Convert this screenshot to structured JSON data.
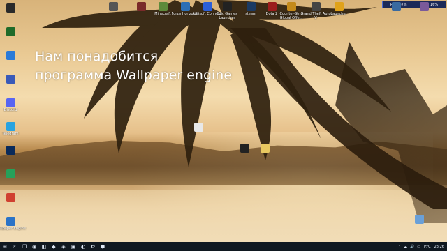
{
  "overlay": {
    "line1": "Нам понадобится",
    "line2": "программа Wallpaper engine"
  },
  "sysmon": {
    "ram": "RAM 37%",
    "cpu": "CPU 16%"
  },
  "top_icons": [
    {
      "label": "",
      "icon": "app-icon",
      "color": "#555"
    },
    {
      "label": "",
      "icon": "app-icon",
      "color": "#7a2a2a"
    },
    {
      "label": "Minecraft",
      "icon": "minecraft-icon",
      "color": "#5d8a3a"
    },
    {
      "label": "Forza Horizon 4",
      "icon": "forza-icon",
      "color": "#2d6fb5"
    },
    {
      "label": "Ubisoft Connect",
      "icon": "ubisoft-icon",
      "color": "#2b5fd9"
    },
    {
      "label": "Epic Games Launcher",
      "icon": "epic-icon",
      "color": "#222"
    },
    {
      "label": "steam",
      "icon": "steam-icon",
      "color": "#1b3a63"
    },
    {
      "label": "Dota 2",
      "icon": "dota-icon",
      "color": "#9b1c1c"
    },
    {
      "label": "Counter-Str... Global Offe...",
      "icon": "csgo-icon",
      "color": "#c48a1a"
    },
    {
      "label": "Grand Theft Auto V",
      "icon": "gta-icon",
      "color": "#444"
    },
    {
      "label": "Launcher",
      "icon": "launcher-icon",
      "color": "#e0a21a"
    },
    {
      "label": "",
      "icon": "app-icon",
      "color": "#3a6aa0"
    },
    {
      "label": "",
      "icon": "app-icon",
      "color": "#7a5a9a"
    }
  ],
  "left_icons": [
    {
      "label": "",
      "icon": "app-icon",
      "color": "#2a2a2a"
    },
    {
      "label": "",
      "icon": "app-icon",
      "color": "#1f6b2a"
    },
    {
      "label": "",
      "icon": "app-icon",
      "color": "#2a7ad8"
    },
    {
      "label": "",
      "icon": "app-icon",
      "color": "#3a5ab8"
    },
    {
      "label": "Discord",
      "icon": "discord-icon",
      "color": "#5865f2"
    },
    {
      "label": "Telegram",
      "icon": "telegram-icon",
      "color": "#2aa3e0"
    },
    {
      "label": "",
      "icon": "app-icon",
      "color": "#0a2a5a"
    },
    {
      "label": "",
      "icon": "app-icon",
      "color": "#26a05a"
    },
    {
      "label": "",
      "icon": "app-icon",
      "color": "#d04030"
    },
    {
      "label": "Wallpaper Engine",
      "icon": "wallpaper-engine-icon",
      "color": "#2b73c7"
    }
  ],
  "desk_icons": [
    {
      "label": "",
      "icon": "file-icon",
      "color": "#e8e8e8"
    },
    {
      "label": "",
      "icon": "file-icon",
      "color": "#222"
    },
    {
      "label": "",
      "icon": "folder-icon",
      "color": "#e8c860"
    },
    {
      "label": "",
      "icon": "recycle-bin-icon",
      "color": "#6aa0d8"
    }
  ],
  "taskbar": {
    "start": "⊞",
    "search": "⌕",
    "task_view": "❐",
    "apps": [
      "◉",
      "◧",
      "◆",
      "◈",
      "▣",
      "◐",
      "✿",
      "⬢"
    ],
    "time": "23:26",
    "lang": "РУС",
    "tray": [
      "⌃",
      "☁",
      "🔊",
      "▭"
    ]
  }
}
